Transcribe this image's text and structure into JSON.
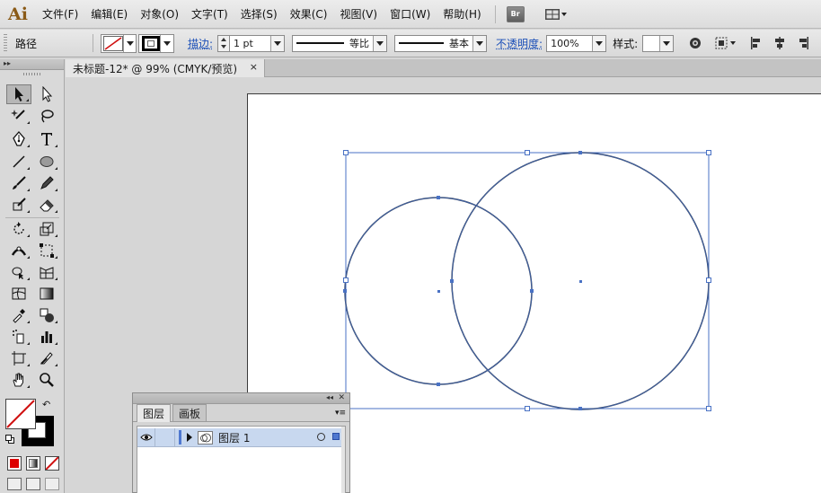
{
  "app": {
    "logo": "Ai"
  },
  "menubar": {
    "items": [
      "文件(F)",
      "编辑(E)",
      "对象(O)",
      "文字(T)",
      "选择(S)",
      "效果(C)",
      "视图(V)",
      "窗口(W)",
      "帮助(H)"
    ],
    "bridge_label": "Br"
  },
  "controlbar": {
    "selection_label": "路径",
    "stroke_label": "描边:",
    "stroke_weight": "1 pt",
    "profile_label": "等比",
    "brush_label": "基本",
    "opacity_label": "不透明度:",
    "opacity_value": "100%",
    "style_label": "样式:"
  },
  "document": {
    "tab_title": "未标题-12* @ 99% (CMYK/预览)",
    "close_glyph": "×"
  },
  "layers_panel": {
    "tabs": [
      "图层",
      "画板"
    ],
    "collapse_glyph": "◂◂",
    "close_glyph": "✕",
    "menu_glyph": "▾≡",
    "layer": {
      "name": "图层 1"
    }
  },
  "colors": {
    "path": "#2b3a55",
    "selection": "#4a72c4",
    "accent_layer": "#c8d8ef",
    "fill_swatch": "#ffffff",
    "stroke_swatch": "#000000",
    "logo": "#8a5a16"
  }
}
